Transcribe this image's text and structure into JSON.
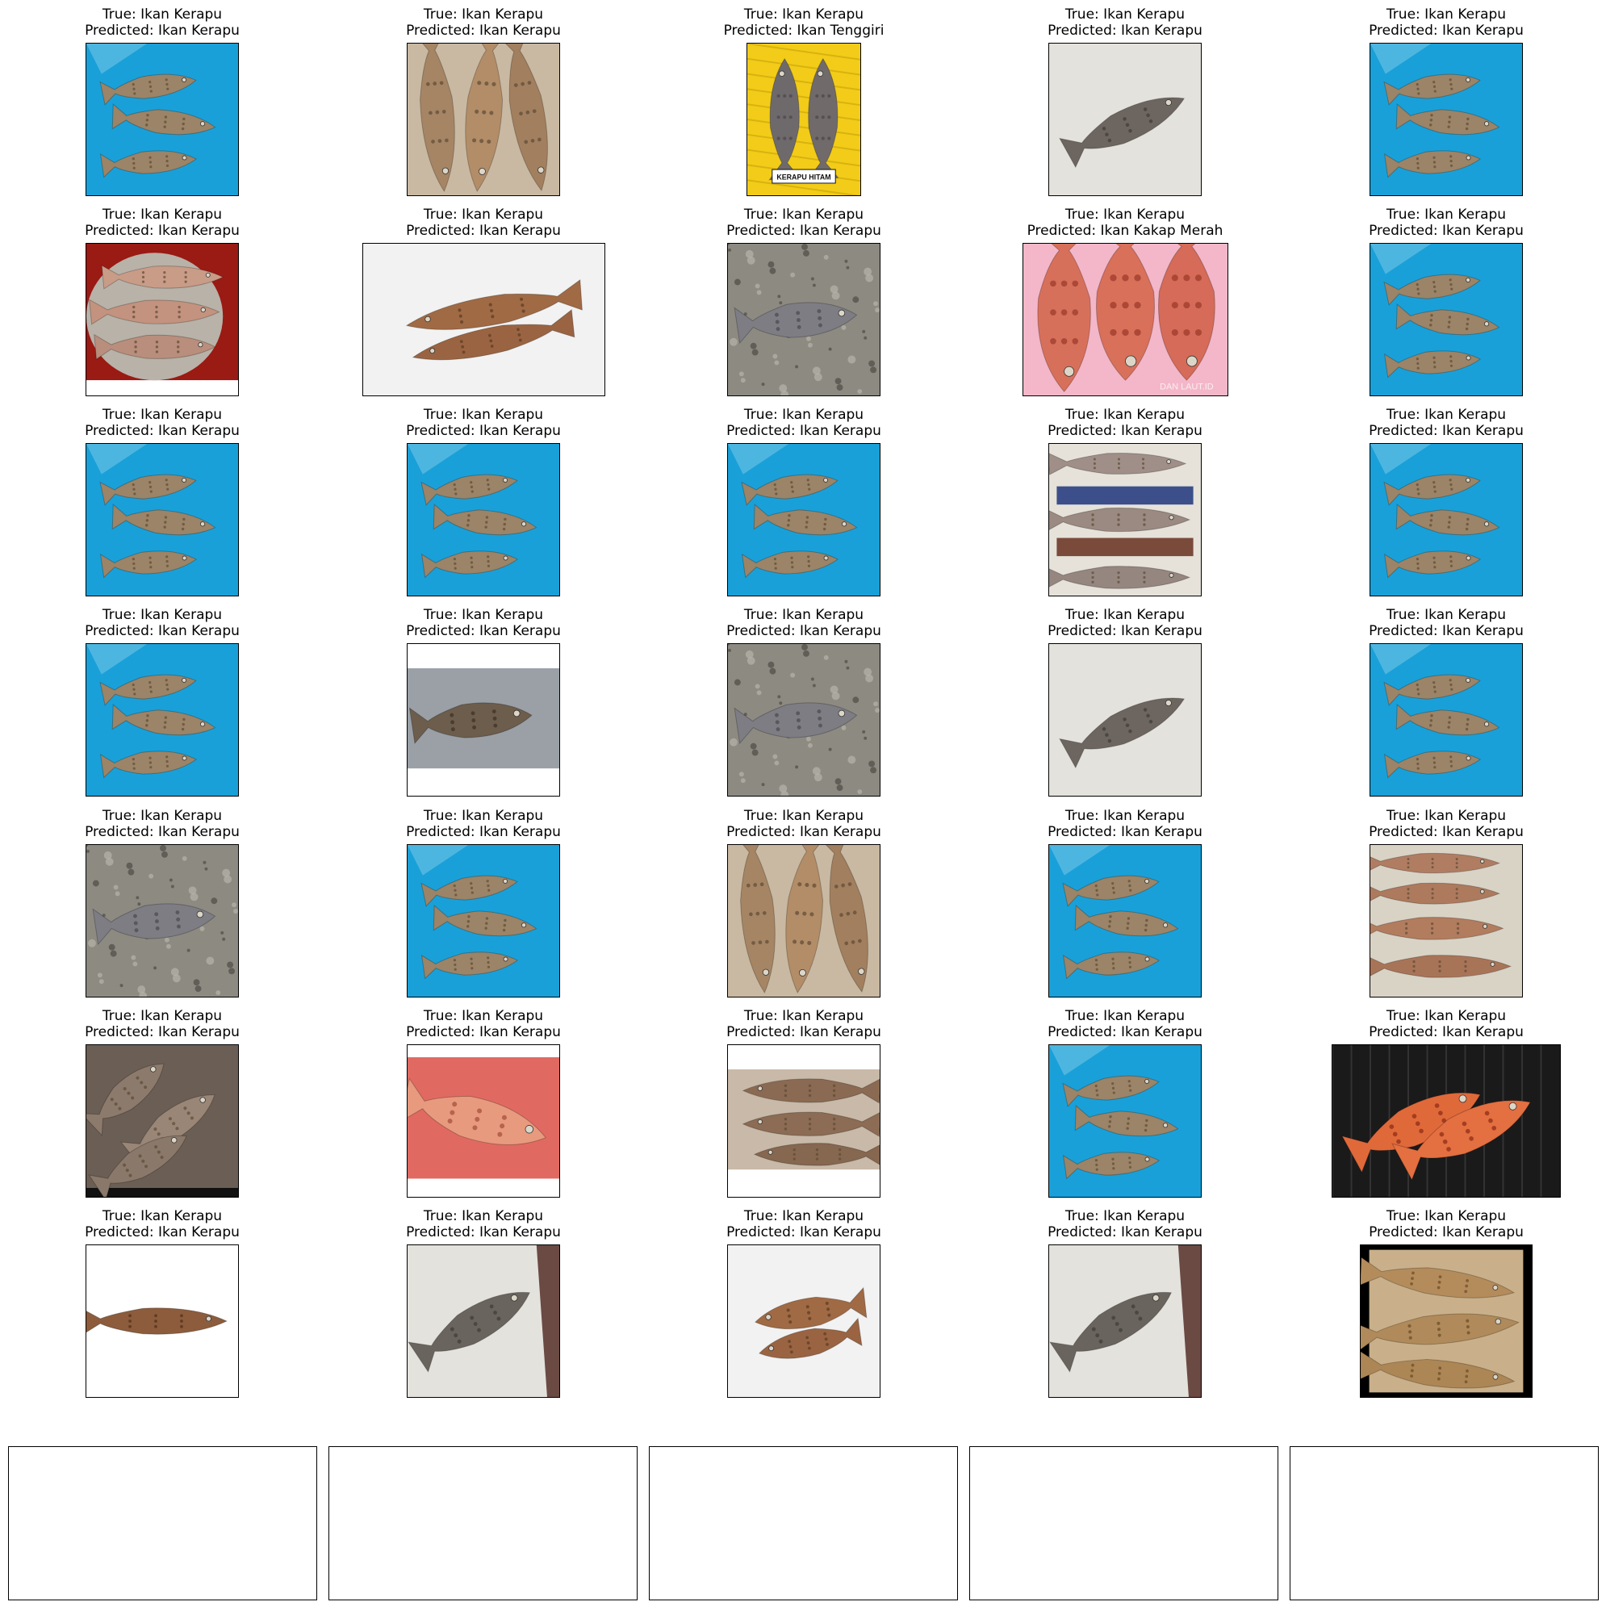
{
  "panels": [
    {
      "true_label": "True: Ikan Kerapu",
      "predicted_label": "Predicted: Ikan Kerapu",
      "scene": "blue",
      "sign": ""
    },
    {
      "true_label": "True: Ikan Kerapu",
      "predicted_label": "Predicted: Ikan Kerapu",
      "scene": "pile",
      "sign": ""
    },
    {
      "true_label": "True: Ikan Kerapu",
      "predicted_label": "Predicted: Ikan Tenggiri",
      "scene": "yellow",
      "sign": "KERAPU HITAM"
    },
    {
      "true_label": "True: Ikan Kerapu",
      "predicted_label": "Predicted: Ikan Kerapu",
      "scene": "floor",
      "sign": ""
    },
    {
      "true_label": "True: Ikan Kerapu",
      "predicted_label": "Predicted: Ikan Kerapu",
      "scene": "blue",
      "sign": ""
    },
    {
      "true_label": "True: Ikan Kerapu",
      "predicted_label": "Predicted: Ikan Kerapu",
      "scene": "redbowl",
      "sign": ""
    },
    {
      "true_label": "True: Ikan Kerapu",
      "predicted_label": "Predicted: Ikan Kerapu",
      "scene": "ice",
      "sign": ""
    },
    {
      "true_label": "True: Ikan Kerapu",
      "predicted_label": "Predicted: Ikan Kerapu",
      "scene": "gravel",
      "sign": ""
    },
    {
      "true_label": "True: Ikan Kerapu",
      "predicted_label": "Predicted: Ikan Kakap Merah",
      "scene": "redfish",
      "sign": "DAN LAUT.ID"
    },
    {
      "true_label": "True: Ikan Kerapu",
      "predicted_label": "Predicted: Ikan Kerapu",
      "scene": "blue",
      "sign": ""
    },
    {
      "true_label": "True: Ikan Kerapu",
      "predicted_label": "Predicted: Ikan Kerapu",
      "scene": "blue",
      "sign": ""
    },
    {
      "true_label": "True: Ikan Kerapu",
      "predicted_label": "Predicted: Ikan Kerapu",
      "scene": "blue",
      "sign": ""
    },
    {
      "true_label": "True: Ikan Kerapu",
      "predicted_label": "Predicted: Ikan Kerapu",
      "scene": "blue",
      "sign": ""
    },
    {
      "true_label": "True: Ikan Kerapu",
      "predicted_label": "Predicted: Ikan Kerapu",
      "scene": "shop",
      "sign": ""
    },
    {
      "true_label": "True: Ikan Kerapu",
      "predicted_label": "Predicted: Ikan Kerapu",
      "scene": "blue",
      "sign": ""
    },
    {
      "true_label": "True: Ikan Kerapu",
      "predicted_label": "Predicted: Ikan Kerapu",
      "scene": "blue",
      "sign": ""
    },
    {
      "true_label": "True: Ikan Kerapu",
      "predicted_label": "Predicted: Ikan Kerapu",
      "scene": "grayband",
      "sign": ""
    },
    {
      "true_label": "True: Ikan Kerapu",
      "predicted_label": "Predicted: Ikan Kerapu",
      "scene": "gravel",
      "sign": ""
    },
    {
      "true_label": "True: Ikan Kerapu",
      "predicted_label": "Predicted: Ikan Kerapu",
      "scene": "floor",
      "sign": ""
    },
    {
      "true_label": "True: Ikan Kerapu",
      "predicted_label": "Predicted: Ikan Kerapu",
      "scene": "blue",
      "sign": ""
    },
    {
      "true_label": "True: Ikan Kerapu",
      "predicted_label": "Predicted: Ikan Kerapu",
      "scene": "gravel",
      "sign": ""
    },
    {
      "true_label": "True: Ikan Kerapu",
      "predicted_label": "Predicted: Ikan Kerapu",
      "scene": "blue",
      "sign": ""
    },
    {
      "true_label": "True: Ikan Kerapu",
      "predicted_label": "Predicted: Ikan Kerapu",
      "scene": "pile",
      "sign": ""
    },
    {
      "true_label": "True: Ikan Kerapu",
      "predicted_label": "Predicted: Ikan Kerapu",
      "scene": "blue",
      "sign": ""
    },
    {
      "true_label": "True: Ikan Kerapu",
      "predicted_label": "Predicted: Ikan Kerapu",
      "scene": "beige",
      "sign": ""
    },
    {
      "true_label": "True: Ikan Kerapu",
      "predicted_label": "Predicted: Ikan Kerapu",
      "scene": "darkpile",
      "sign": ""
    },
    {
      "true_label": "True: Ikan Kerapu",
      "predicted_label": "Predicted: Ikan Kerapu",
      "scene": "pinkbasket",
      "sign": ""
    },
    {
      "true_label": "True: Ikan Kerapu",
      "predicted_label": "Predicted: Ikan Kerapu",
      "scene": "whiteband",
      "sign": ""
    },
    {
      "true_label": "True: Ikan Kerapu",
      "predicted_label": "Predicted: Ikan Kerapu",
      "scene": "blue",
      "sign": ""
    },
    {
      "true_label": "True: Ikan Kerapu",
      "predicted_label": "Predicted: Ikan Kerapu",
      "scene": "grill",
      "sign": ""
    },
    {
      "true_label": "True: Ikan Kerapu",
      "predicted_label": "Predicted: Ikan Kerapu",
      "scene": "white",
      "sign": ""
    },
    {
      "true_label": "True: Ikan Kerapu",
      "predicted_label": "Predicted: Ikan Kerapu",
      "scene": "floorcorner",
      "sign": ""
    },
    {
      "true_label": "True: Ikan Kerapu",
      "predicted_label": "Predicted: Ikan Kerapu",
      "scene": "ice",
      "sign": ""
    },
    {
      "true_label": "True: Ikan Kerapu",
      "predicted_label": "Predicted: Ikan Kerapu",
      "scene": "floorcorner",
      "sign": ""
    },
    {
      "true_label": "True: Ikan Kerapu",
      "predicted_label": "Predicted: Ikan Kerapu",
      "scene": "blackframe",
      "sign": ""
    }
  ],
  "empty_axes_count": 5,
  "colors": {
    "blue_tarp": "#1aa0d8",
    "fish_brown": "#9b8467",
    "fish_red": "#d7705a",
    "yellow_crate": "#f2cc18",
    "floor_gray": "#e4e2dc",
    "gravel_gray": "#8d8a82"
  }
}
